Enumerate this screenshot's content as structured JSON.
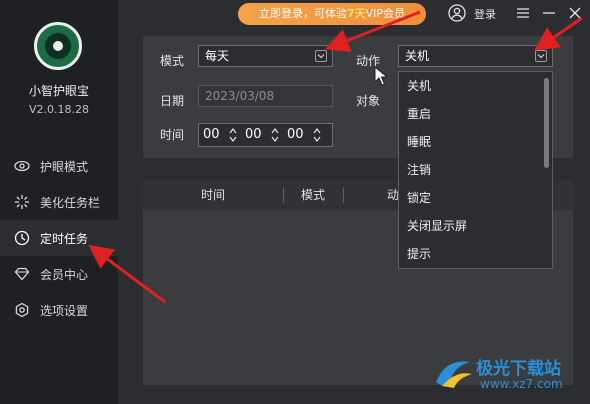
{
  "app": {
    "name": "小智护眼宝",
    "version": "V2.0.18.28"
  },
  "topbar": {
    "promo_prefix": "立即登录，可体验",
    "promo_highlight": "7天",
    "promo_suffix": "VIP会员",
    "login_label": "登录"
  },
  "sidebar": {
    "items": [
      {
        "label": "护眼模式",
        "icon": "eye-icon",
        "active": false
      },
      {
        "label": "美化任务栏",
        "icon": "sparkle-icon",
        "active": false
      },
      {
        "label": "定时任务",
        "icon": "clock-icon",
        "active": true
      },
      {
        "label": "会员中心",
        "icon": "diamond-icon",
        "active": false
      },
      {
        "label": "选项设置",
        "icon": "settings-icon",
        "active": false
      }
    ]
  },
  "form": {
    "mode_label": "模式",
    "mode_value": "每天",
    "date_label": "日期",
    "date_value": "2023/03/08",
    "time_label": "时间",
    "time_h": "00",
    "time_m": "00",
    "time_s": "00",
    "action_label": "动作",
    "action_value": "关机",
    "target_label": "对象"
  },
  "action_options": [
    "关机",
    "重启",
    "睡眠",
    "注销",
    "锁定",
    "关闭显示屏",
    "提示"
  ],
  "table": {
    "columns": [
      "时间",
      "模式",
      "动"
    ]
  },
  "watermark": {
    "text": "极光下载站",
    "url": "www.xz7.com"
  },
  "colors": {
    "accent_arrow": "#e02020",
    "promo": "#f08f3a",
    "brand_green": "#1b6b44"
  }
}
